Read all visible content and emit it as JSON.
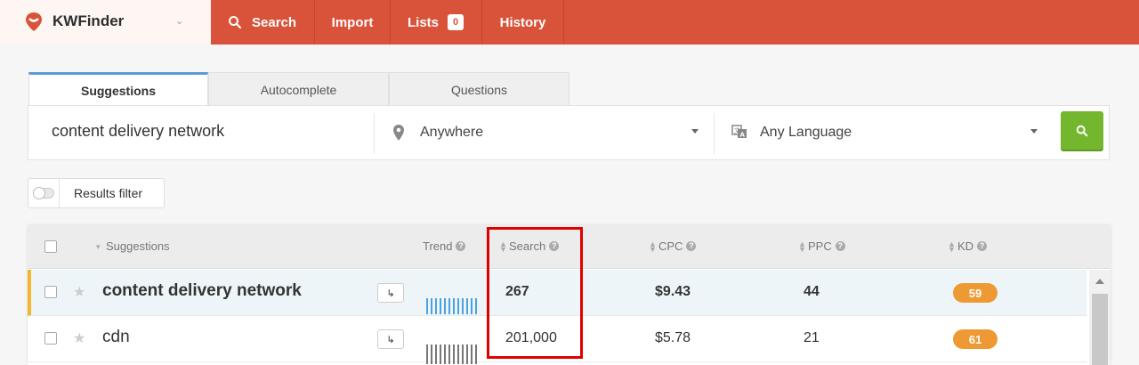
{
  "brand": {
    "name": "KWFinder",
    "caret": "⌄"
  },
  "nav": {
    "search": "Search",
    "import": "Import",
    "lists": "Lists",
    "lists_count": "0",
    "history": "History"
  },
  "tabs": {
    "suggestions": "Suggestions",
    "autocomplete": "Autocomplete",
    "questions": "Questions"
  },
  "search": {
    "keyword": "content delivery network",
    "location": "Anywhere",
    "language": "Any Language"
  },
  "filter": {
    "label": "Results filter"
  },
  "table": {
    "headers": {
      "suggestions": "Suggestions",
      "trend": "Trend",
      "search": "Search",
      "cpc": "CPC",
      "ppc": "PPC",
      "kd": "KD"
    },
    "rows": [
      {
        "keyword": "content delivery network",
        "search": "267",
        "cpc": "$9.43",
        "ppc": "44",
        "kd": "59",
        "trend": [
          6,
          6,
          6,
          6,
          6,
          6,
          6,
          6,
          6,
          6,
          6,
          6
        ]
      },
      {
        "keyword": "cdn",
        "search": "201,000",
        "cpc": "$5.78",
        "ppc": "21",
        "kd": "61",
        "trend": [
          6,
          6,
          6,
          6,
          6,
          6,
          6,
          6,
          6,
          6,
          6,
          6
        ]
      }
    ]
  },
  "colors": {
    "brand_red": "#d9533a",
    "go_green": "#74b72e",
    "kd_orange": "#ee9a34",
    "highlight": "#e00000",
    "trend_row1": "#4aa3df",
    "trend_row2": "#777777"
  }
}
